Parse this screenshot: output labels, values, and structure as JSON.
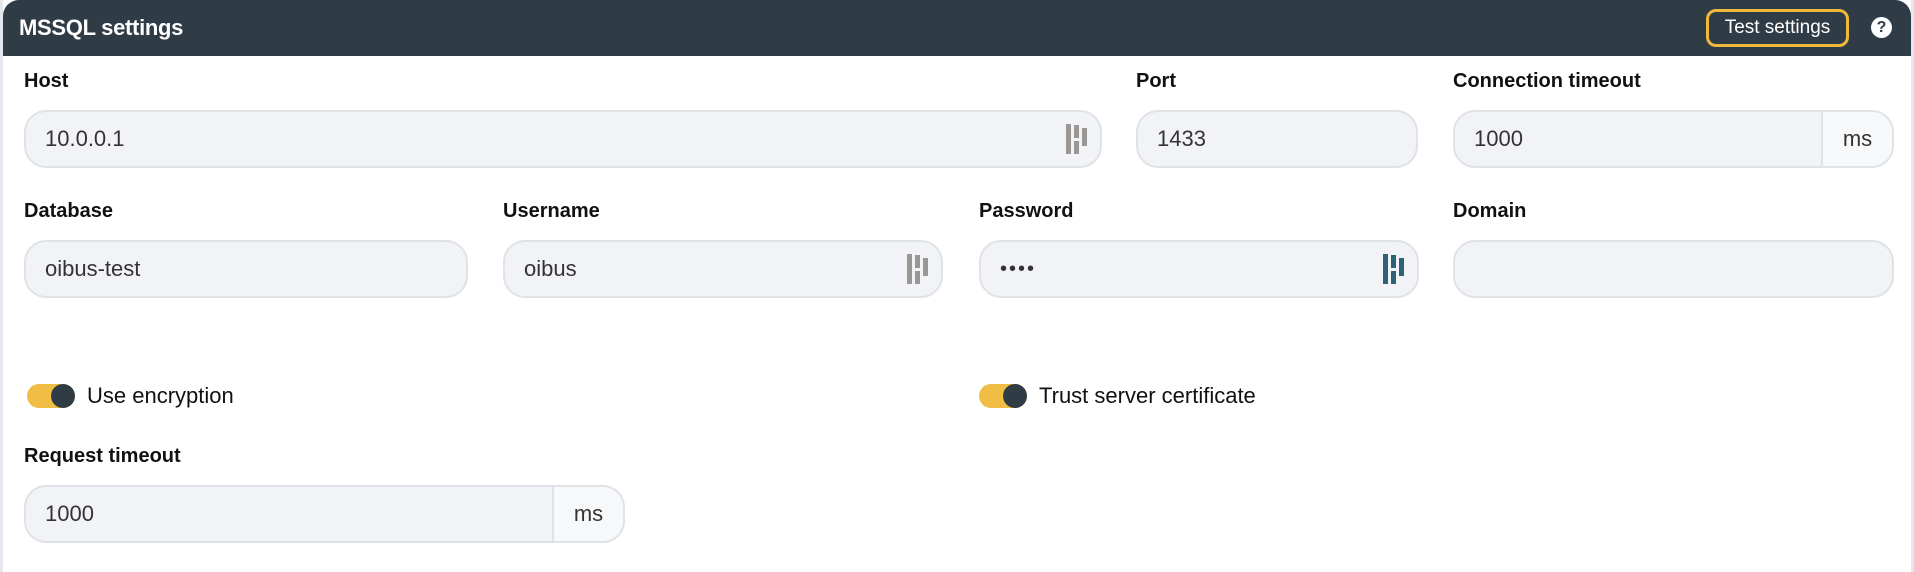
{
  "header": {
    "title": "MSSQL settings",
    "test_button_label": "Test settings",
    "help_icon": "question-circle-icon",
    "help_glyph": "?"
  },
  "colors": {
    "header_bg": "#2f3b45",
    "accent": "#f0b93b",
    "toggle_on": "#f0bd45",
    "password_manager_active": "#2e6377",
    "password_manager_inactive": "#9a9795"
  },
  "fields": {
    "host": {
      "label": "Host",
      "value": "10.0.0.1",
      "icon": "password-manager-icon"
    },
    "port": {
      "label": "Port",
      "value": "1433"
    },
    "connection_timeout": {
      "label": "Connection timeout",
      "value": "1000",
      "unit": "ms"
    },
    "database": {
      "label": "Database",
      "value": "oibus-test"
    },
    "username": {
      "label": "Username",
      "value": "oibus",
      "icon": "password-manager-icon"
    },
    "password": {
      "label": "Password",
      "value": "••••",
      "icon": "password-manager-icon"
    },
    "domain": {
      "label": "Domain",
      "value": ""
    },
    "request_timeout": {
      "label": "Request timeout",
      "value": "1000",
      "unit": "ms"
    }
  },
  "toggles": {
    "use_encryption": {
      "label": "Use encryption",
      "checked": true
    },
    "trust_server_certificate": {
      "label": "Trust server certificate",
      "checked": true
    }
  }
}
